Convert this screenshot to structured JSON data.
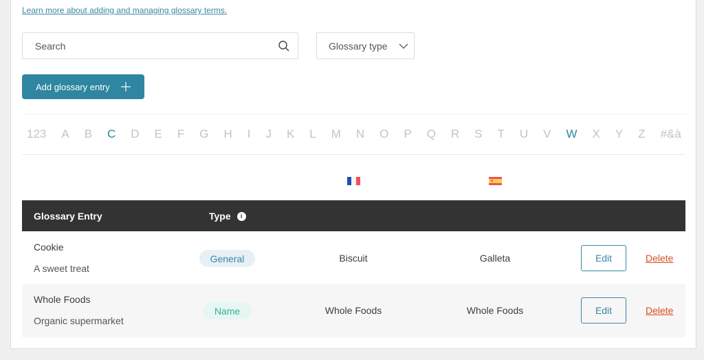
{
  "help_link": "Learn more about adding and managing glossary terms.",
  "search": {
    "placeholder": "Search",
    "value": ""
  },
  "type_filter": {
    "label": "Glossary type"
  },
  "add_button": {
    "label": "Add glossary entry"
  },
  "alphabet": {
    "letters": [
      "123",
      "A",
      "B",
      "C",
      "D",
      "E",
      "F",
      "G",
      "H",
      "I",
      "J",
      "K",
      "L",
      "M",
      "N",
      "O",
      "P",
      "Q",
      "R",
      "S",
      "T",
      "U",
      "V",
      "W",
      "X",
      "Y",
      "Z",
      "#&à"
    ],
    "active": [
      "C",
      "W"
    ]
  },
  "languages": [
    {
      "code": "fr",
      "flag": "france-flag"
    },
    {
      "code": "es",
      "flag": "spain-flag"
    }
  ],
  "table": {
    "headers": {
      "entry": "Glossary Entry",
      "type": "Type",
      "type_info": "i"
    },
    "rows": [
      {
        "term": "Cookie",
        "description": "A sweet treat",
        "type": "General",
        "fr": "Biscuit",
        "es": "Galleta",
        "edit": "Edit",
        "delete": "Delete"
      },
      {
        "term": "Whole Foods",
        "description": "Organic supermarket",
        "type": "Name",
        "fr": "Whole Foods",
        "es": "Whole Foods",
        "edit": "Edit",
        "delete": "Delete"
      }
    ]
  },
  "colors": {
    "accent": "#2e86a0",
    "delete": "#d54e21",
    "header_bg": "#333333",
    "name_badge": "#35b193"
  }
}
